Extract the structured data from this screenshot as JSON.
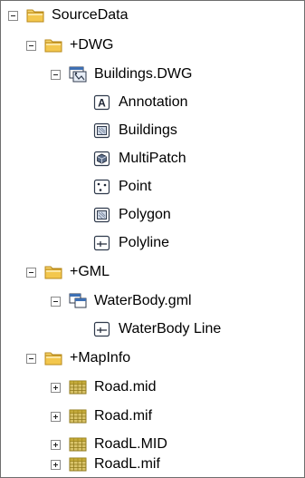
{
  "tree": {
    "root": {
      "label": "SourceData"
    },
    "dwg": {
      "folder": {
        "label": "+DWG"
      },
      "file": {
        "label": "Buildings.DWG"
      },
      "children": [
        {
          "label": "Annotation",
          "icon": "annotation-icon"
        },
        {
          "label": "Buildings",
          "icon": "polygon-feature-icon"
        },
        {
          "label": "MultiPatch",
          "icon": "multipatch-icon"
        },
        {
          "label": "Point",
          "icon": "point-feature-icon"
        },
        {
          "label": "Polygon",
          "icon": "polygon-feature-icon"
        },
        {
          "label": "Polyline",
          "icon": "polyline-feature-icon"
        }
      ]
    },
    "gml": {
      "folder": {
        "label": "+GML"
      },
      "file": {
        "label": "WaterBody.gml"
      },
      "children": [
        {
          "label": "WaterBody Line",
          "icon": "polyline-feature-icon"
        }
      ]
    },
    "mapinfo": {
      "folder": {
        "label": "+MapInfo"
      },
      "files": [
        {
          "label": "Road.mid",
          "icon": "table-grid-icon"
        },
        {
          "label": "Road.mif",
          "icon": "table-grid-icon"
        },
        {
          "label": "RoadL.MID",
          "icon": "table-grid-icon"
        },
        {
          "label": "RoadL.mif",
          "icon": "table-grid-icon"
        }
      ]
    }
  },
  "colors": {
    "folder": "#f3c74d",
    "icon_border": "#2f3a4c",
    "grid": "#b59a1e"
  }
}
